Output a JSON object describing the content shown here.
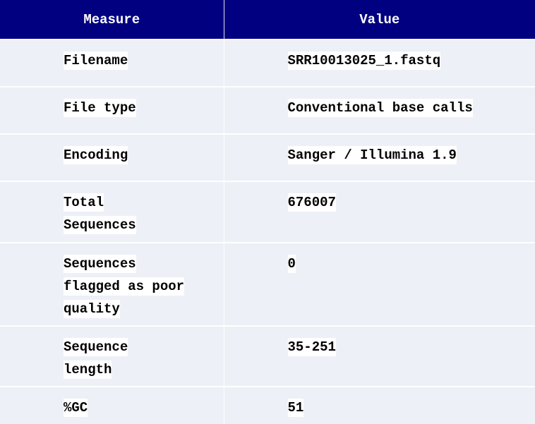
{
  "table": {
    "headers": [
      "Measure",
      "Value"
    ],
    "rows": [
      {
        "measure": "Filename",
        "value": "SRR10013025_1.fastq"
      },
      {
        "measure": "File type",
        "value": "Conventional base calls"
      },
      {
        "measure": "Encoding",
        "value": "Sanger / Illumina 1.9"
      },
      {
        "measure": "Total Sequences",
        "value": "676007"
      },
      {
        "measure": "Sequences flagged as poor quality",
        "value": "0"
      },
      {
        "measure": "Sequence length",
        "value": "35-251"
      },
      {
        "measure": "%GC",
        "value": "51"
      }
    ]
  },
  "colors": {
    "header_bg": "#000080",
    "header_text": "#ffffff",
    "row_bg": "#eef0f7",
    "text_highlight": "#ffffff"
  }
}
